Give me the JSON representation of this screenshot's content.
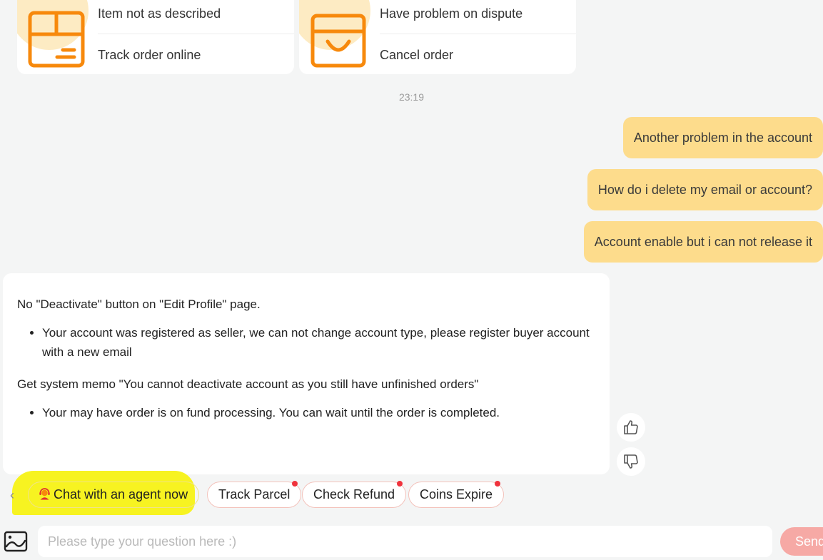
{
  "shortcuts": {
    "left_card": {
      "icon": "package-box-icon",
      "links": [
        "Item not as described",
        "Track order online"
      ]
    },
    "right_card": {
      "icon": "shopping-bag-icon",
      "links": [
        "Have problem on dispute",
        "Cancel order"
      ]
    }
  },
  "timestamp": "23:19",
  "user_messages": [
    "Another problem in the account",
    "How do i delete my email or account?",
    "Account enable but i can not release it"
  ],
  "bot_message": {
    "paragraph_1": "No \"Deactivate\" button on \"Edit Profile\" page.",
    "bullet_1": "Your account was registered as seller, we can not change account type, please register buyer account with a new email",
    "paragraph_2": "Get system memo \"You cannot deactivate account as you still have unfinished orders\"",
    "bullet_2": "Your may have order is on fund processing. You can wait until the order is completed."
  },
  "feedback": {
    "like_icon": "thumbs-up-icon",
    "dislike_icon": "thumbs-down-icon"
  },
  "quick_replies": {
    "prev_icon": "chevron-left-icon",
    "agent_label": "Chat with an agent now",
    "agent_icon": "support-agent-icon",
    "chips": [
      "Track Parcel",
      "Check Refund",
      "Coins Expire"
    ]
  },
  "composer": {
    "image_icon": "image-upload-icon",
    "placeholder": "Please type your question here :)",
    "value": "",
    "send_label": "Send"
  },
  "colors": {
    "accent_orange": "#f7890c",
    "user_bubble": "#fddc8c",
    "send_button": "#f6a9a5",
    "notification_dot": "#f0323c",
    "highlight_yellow": "#f7f321"
  }
}
